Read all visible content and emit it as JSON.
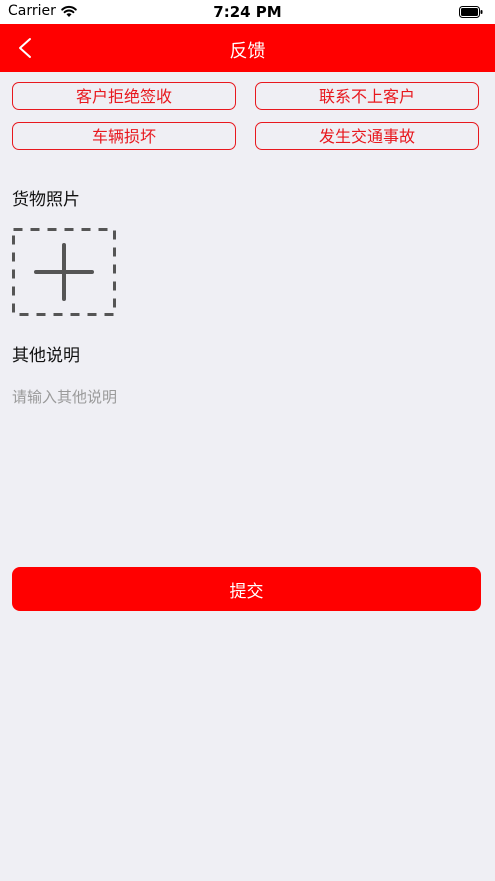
{
  "status_bar": {
    "carrier": "Carrier",
    "time": "7:24 PM",
    "icons": [
      "wifi-icon",
      "battery-icon"
    ]
  },
  "nav": {
    "title": "反馈",
    "back_icon": "chevron-left-icon"
  },
  "reasons": [
    {
      "label": "客户拒绝签收"
    },
    {
      "label": "联系不上客户"
    },
    {
      "label": "车辆损坏"
    },
    {
      "label": "发生交通事故"
    }
  ],
  "photo": {
    "label": "货物照片",
    "add_icon": "plus-icon"
  },
  "description": {
    "label": "其他说明",
    "placeholder": "请输入其他说明",
    "value": ""
  },
  "submit": {
    "label": "提交"
  },
  "colors": {
    "primary": "#ff0000",
    "outline": "#e8181e",
    "background": "#efeff4",
    "placeholder": "#9a9a9a"
  }
}
